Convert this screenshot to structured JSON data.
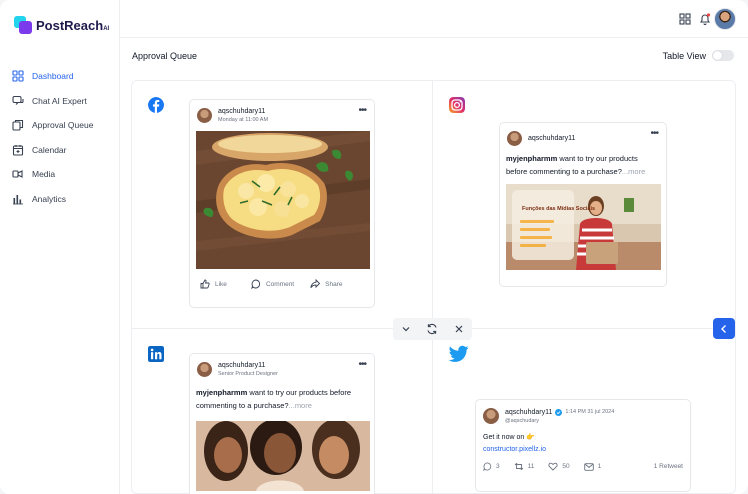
{
  "app": {
    "logo_text": "PostReach",
    "logo_suffix": "AI"
  },
  "sidebar": {
    "items": [
      {
        "label": "Dashboard",
        "icon": "grid-icon",
        "active": true
      },
      {
        "label": "Chat AI Expert",
        "icon": "chat-icon",
        "active": false
      },
      {
        "label": "Approval Queue",
        "icon": "queue-icon",
        "active": false
      },
      {
        "label": "Calendar",
        "icon": "calendar-icon",
        "active": false
      },
      {
        "label": "Media",
        "icon": "media-icon",
        "active": false
      },
      {
        "label": "Analytics",
        "icon": "analytics-icon",
        "active": false
      }
    ]
  },
  "header": {
    "page_title": "Approval Queue",
    "table_view_label": "Table View"
  },
  "colors": {
    "accent": "#2563eb",
    "facebook": "#1877f2",
    "linkedin": "#0a66c2",
    "twitter": "#1d9bf0"
  },
  "facebook_post": {
    "username": "aqschuhdary11",
    "subtitle": "Monday at 11:00 AM",
    "like_label": "Like",
    "comment_label": "Comment",
    "share_label": "Share"
  },
  "instagram_post": {
    "username": "aqschuhdary11",
    "text_user": "myjenpharmm",
    "text_body": " want to try our products before commenting to a purchase?",
    "more": "...more",
    "image_title": "Funções das Mídias Sociais"
  },
  "linkedin_post": {
    "username": "aqschuhdary11",
    "subtitle": "Senior Product Designer",
    "text_user": "myjenpharmm",
    "text_body": " want to try our products before commenting to a purchase?",
    "more": "...more"
  },
  "twitter_post": {
    "username": "aqschuhdary11",
    "handle": "@aqschudary",
    "timestamp": "1:14 PM 31 jul 2024",
    "text": "Get it now on",
    "link": "constructor.pixellz.io",
    "replies": "3",
    "retweets": "11",
    "likes": "50",
    "shares": "1",
    "retweet_summary": "1 Retweet"
  }
}
